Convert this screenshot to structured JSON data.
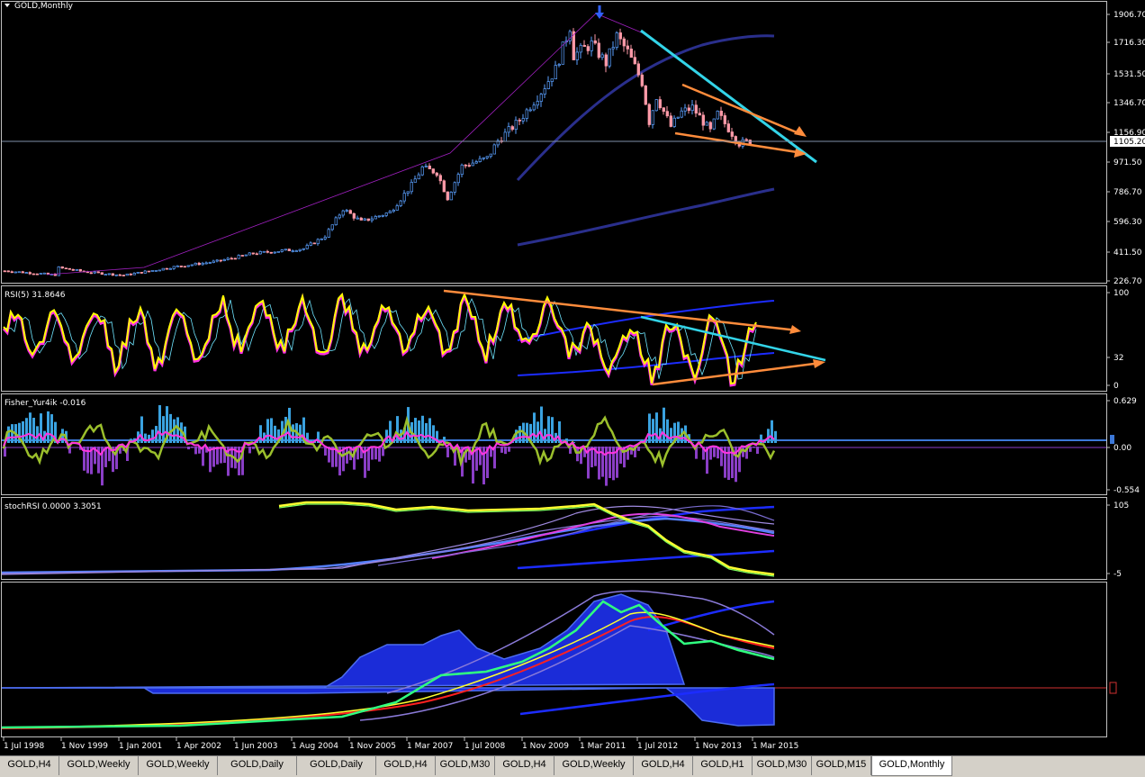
{
  "chart_title": "GOLD,Monthly",
  "price_axis": {
    "ticks": [
      "1906.70",
      "1716.30",
      "1531.50",
      "1346.70",
      "1156.90",
      "971.50",
      "786.70",
      "596.30",
      "411.50",
      "226.70"
    ],
    "current_price": "1105.20"
  },
  "time_axis": [
    "1 Jul 1998",
    "1 Nov 1999",
    "1 Jan 2001",
    "1 Apr 2002",
    "1 Jun 2003",
    "1 Aug 2004",
    "1 Nov 2005",
    "1 Mar 2007",
    "1 Jul 2008",
    "1 Nov 2009",
    "1 Mar 2011",
    "1 Jul 2012",
    "1 Nov 2013",
    "1 Mar 2015"
  ],
  "rsi_panel": {
    "label": "RSI(5) 31.8646",
    "ticks": [
      "100",
      "32",
      "0"
    ]
  },
  "fisher_panel": {
    "label": "Fisher_Yur4ik -0.016",
    "ticks": [
      "0.629",
      "0.00",
      "-0.554"
    ]
  },
  "stoch_panel": {
    "label": "stochRSI 0.0000 3.3051",
    "ticks": [
      "105",
      "-5"
    ]
  },
  "tabs": [
    "GOLD,H4",
    "GOLD,Weekly",
    "GOLD,Weekly",
    "GOLD,Daily",
    "GOLD,Daily",
    "GOLD,H4",
    "GOLD,M30",
    "GOLD,H4",
    "GOLD,Weekly",
    "GOLD,H4",
    "GOLD,H1",
    "GOLD,M30",
    "GOLD,M15",
    "GOLD,Monthly"
  ],
  "active_tab": "GOLD,Monthly",
  "colors": {
    "background": "#000000",
    "candle_up": "#5aa0ff",
    "candle_down": "#ff9aa8",
    "rsi": "#ffff00",
    "trend_cyan": "#33d4e8",
    "trend_orange": "#ff8c3c",
    "fisher_pos": "#3aa2e0",
    "fisher_neg": "#8a3ec6",
    "fisher_line": "#ff35dd",
    "fisher_green": "#9bbf2c"
  },
  "chart_data": [
    {
      "type": "candlestick",
      "title": "GOLD,Monthly",
      "x_range": [
        "1 Jul 1998",
        "1 Oct 2015"
      ],
      "y_range": [
        140,
        1960
      ],
      "close_path": [
        [
          "1998-07",
          290
        ],
        [
          "1999-09",
          265
        ],
        [
          "1999-10",
          310
        ],
        [
          "2000-06",
          282
        ],
        [
          "2001-04",
          262
        ],
        [
          "2002-06",
          315
        ],
        [
          "2003-06",
          350
        ],
        [
          "2004-04",
          400
        ],
        [
          "2005-06",
          430
        ],
        [
          "2005-12",
          510
        ],
        [
          "2006-05",
          680
        ],
        [
          "2006-10",
          600
        ],
        [
          "2007-06",
          660
        ],
        [
          "2007-12",
          830
        ],
        [
          "2008-03",
          940
        ],
        [
          "2008-07",
          910
        ],
        [
          "2008-10",
          750
        ],
        [
          "2009-02",
          950
        ],
        [
          "2009-09",
          1000
        ],
        [
          "2009-12",
          1110
        ],
        [
          "2010-06",
          1240
        ],
        [
          "2010-12",
          1420
        ],
        [
          "2011-04",
          1560
        ],
        [
          "2011-08",
          1830
        ],
        [
          "2011-09",
          1650
        ],
        [
          "2012-02",
          1720
        ],
        [
          "2012-06",
          1600
        ],
        [
          "2012-09",
          1770
        ],
        [
          "2012-12",
          1670
        ],
        [
          "2013-04",
          1480
        ],
        [
          "2013-06",
          1230
        ],
        [
          "2013-08",
          1390
        ],
        [
          "2013-12",
          1200
        ],
        [
          "2014-03",
          1290
        ],
        [
          "2014-06",
          1320
        ],
        [
          "2014-11",
          1170
        ],
        [
          "2015-01",
          1280
        ],
        [
          "2015-07",
          1095
        ],
        [
          "2015-10",
          1105
        ]
      ],
      "annotations": [
        "ATH peak ~1920 (Sep 2011)",
        "cyan descending trendline",
        "orange wedge lines",
        "moving-average envelope"
      ]
    },
    {
      "type": "line",
      "title": "RSI(5) 31.8646",
      "y_range": [
        0,
        100
      ]
    },
    {
      "type": "bar",
      "title": "Fisher_Yur4ik -0.016",
      "y_range": [
        -0.554,
        0.629
      ]
    },
    {
      "type": "line",
      "title": "stochRSI 0.0000 3.3051",
      "y_range": [
        -5,
        105
      ]
    },
    {
      "type": "area",
      "title": "",
      "y_range": [
        -1,
        1
      ]
    }
  ]
}
